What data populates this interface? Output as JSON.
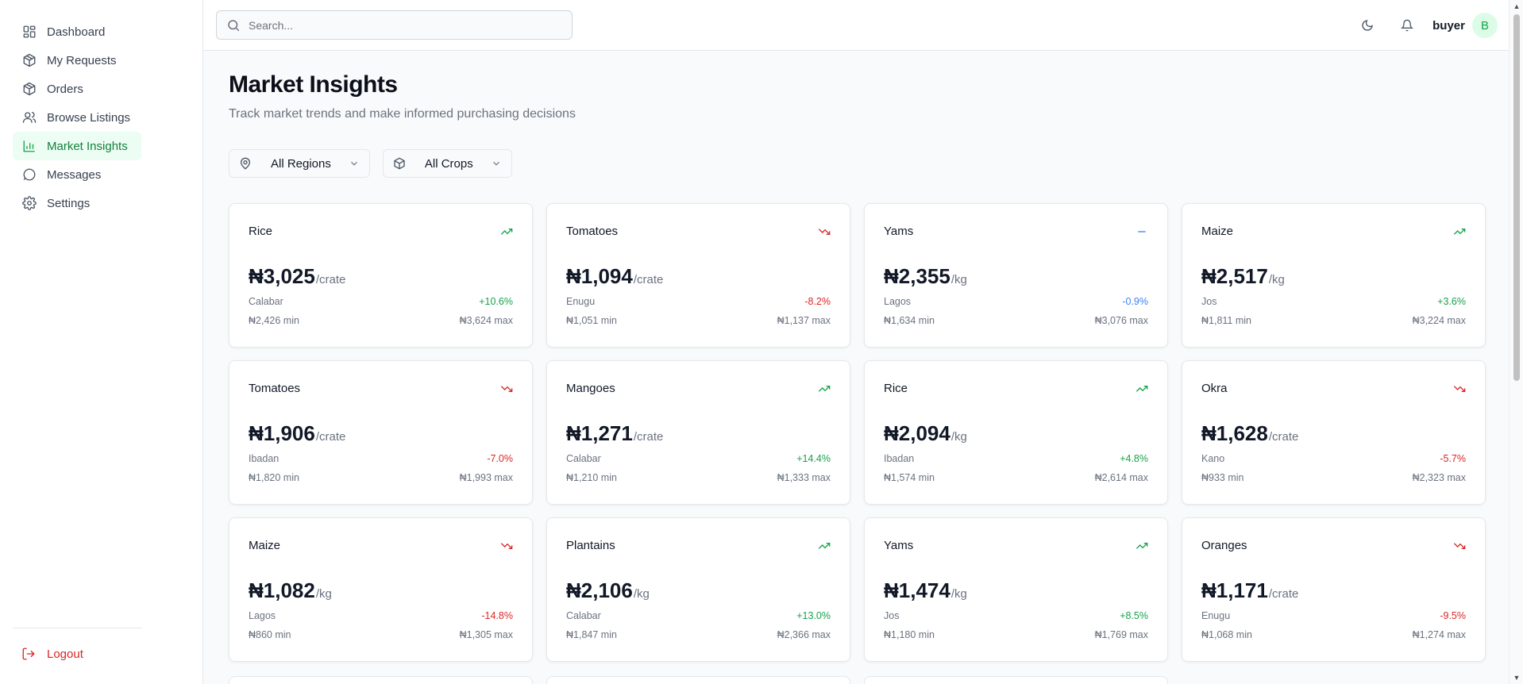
{
  "sidebar": {
    "items": [
      {
        "label": "Dashboard",
        "icon": "dashboard-icon"
      },
      {
        "label": "My Requests",
        "icon": "package-icon"
      },
      {
        "label": "Orders",
        "icon": "package-icon"
      },
      {
        "label": "Browse Listings",
        "icon": "users-icon"
      },
      {
        "label": "Market Insights",
        "icon": "bar-chart-icon",
        "active": true
      },
      {
        "label": "Messages",
        "icon": "message-icon"
      },
      {
        "label": "Settings",
        "icon": "gear-icon"
      }
    ],
    "logout_label": "Logout"
  },
  "header": {
    "search_placeholder": "Search...",
    "username": "buyer",
    "avatar_initial": "B"
  },
  "page": {
    "title": "Market Insights",
    "subtitle": "Track market trends and make informed purchasing decisions"
  },
  "filters": {
    "region": "All Regions",
    "crop": "All Crops"
  },
  "colors": {
    "accent": "#16a34a",
    "up": "#16a34a",
    "down": "#dc2626",
    "flat": "#3b82f6"
  },
  "cards": [
    {
      "crop": "Rice",
      "trend": "up",
      "price": "₦3,025",
      "unit": "/crate",
      "location": "Calabar",
      "change": "+10.6%",
      "min": "₦2,426 min",
      "max": "₦3,624 max"
    },
    {
      "crop": "Tomatoes",
      "trend": "down",
      "price": "₦1,094",
      "unit": "/crate",
      "location": "Enugu",
      "change": "-8.2%",
      "min": "₦1,051 min",
      "max": "₦1,137 max"
    },
    {
      "crop": "Yams",
      "trend": "flat",
      "price": "₦2,355",
      "unit": "/kg",
      "location": "Lagos",
      "change": "-0.9%",
      "min": "₦1,634 min",
      "max": "₦3,076 max"
    },
    {
      "crop": "Maize",
      "trend": "up",
      "price": "₦2,517",
      "unit": "/kg",
      "location": "Jos",
      "change": "+3.6%",
      "min": "₦1,811 min",
      "max": "₦3,224 max"
    },
    {
      "crop": "Tomatoes",
      "trend": "down",
      "price": "₦1,906",
      "unit": "/crate",
      "location": "Ibadan",
      "change": "-7.0%",
      "min": "₦1,820 min",
      "max": "₦1,993 max"
    },
    {
      "crop": "Mangoes",
      "trend": "up",
      "price": "₦1,271",
      "unit": "/crate",
      "location": "Calabar",
      "change": "+14.4%",
      "min": "₦1,210 min",
      "max": "₦1,333 max"
    },
    {
      "crop": "Rice",
      "trend": "up",
      "price": "₦2,094",
      "unit": "/kg",
      "location": "Ibadan",
      "change": "+4.8%",
      "min": "₦1,574 min",
      "max": "₦2,614 max"
    },
    {
      "crop": "Okra",
      "trend": "down",
      "price": "₦1,628",
      "unit": "/crate",
      "location": "Kano",
      "change": "-5.7%",
      "min": "₦933 min",
      "max": "₦2,323 max"
    },
    {
      "crop": "Maize",
      "trend": "down",
      "price": "₦1,082",
      "unit": "/kg",
      "location": "Lagos",
      "change": "-14.8%",
      "min": "₦860 min",
      "max": "₦1,305 max"
    },
    {
      "crop": "Plantains",
      "trend": "up",
      "price": "₦2,106",
      "unit": "/kg",
      "location": "Calabar",
      "change": "+13.0%",
      "min": "₦1,847 min",
      "max": "₦2,366 max"
    },
    {
      "crop": "Yams",
      "trend": "up",
      "price": "₦1,474",
      "unit": "/kg",
      "location": "Jos",
      "change": "+8.5%",
      "min": "₦1,180 min",
      "max": "₦1,769 max"
    },
    {
      "crop": "Oranges",
      "trend": "down",
      "price": "₦1,171",
      "unit": "/crate",
      "location": "Enugu",
      "change": "-9.5%",
      "min": "₦1,068 min",
      "max": "₦1,274 max"
    }
  ]
}
